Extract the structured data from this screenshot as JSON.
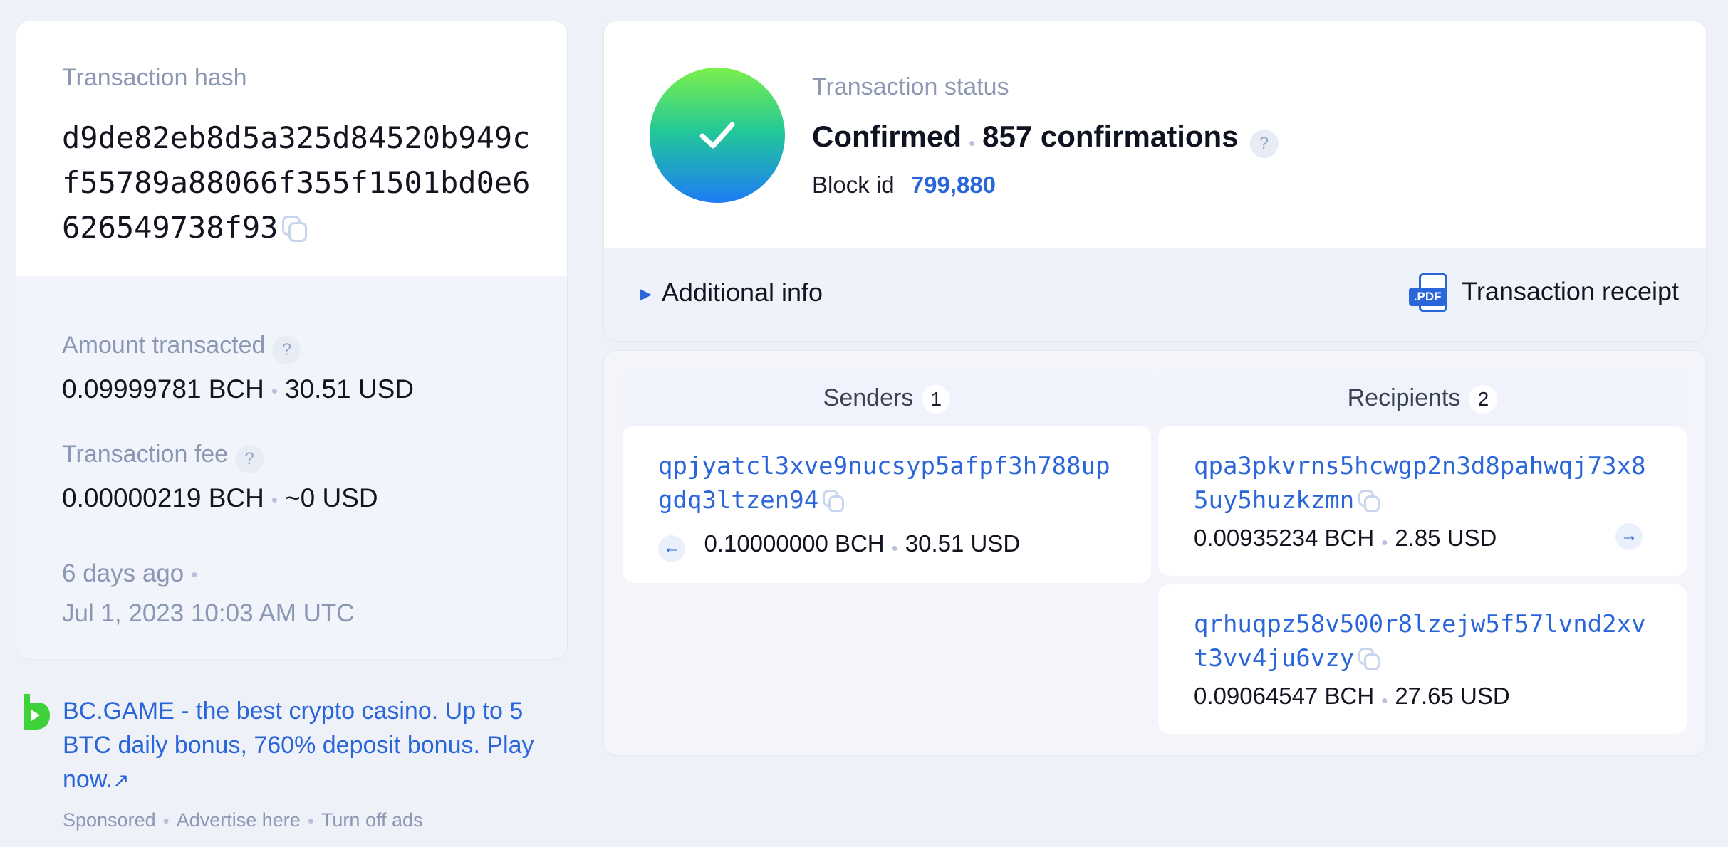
{
  "tx": {
    "hash_label": "Transaction hash",
    "hash": "d9de82eb8d5a325d84520b949cf55789a88066f355f1501bd0e6626549738f93",
    "amount_label": "Amount transacted",
    "amount_bch": "0.09999781 BCH",
    "amount_usd": "30.51 USD",
    "fee_label": "Transaction fee",
    "fee_bch": "0.00000219 BCH",
    "fee_usd": "~0 USD",
    "time_ago": "6 days ago",
    "datetime": "Jul 1, 2023 10:03 AM UTC"
  },
  "status": {
    "label": "Transaction status",
    "state": "Confirmed",
    "confirmations": "857 confirmations",
    "block_label": "Block id",
    "block_id": "799,880",
    "additional_info": "Additional info",
    "receipt": "Transaction receipt",
    "pdf_badge": ".PDF"
  },
  "senders": {
    "title": "Senders",
    "count": "1",
    "items": [
      {
        "address": "qpjyatcl3xve9nucsyp5afpf3h788upgdq3ltzen94",
        "bch": "0.10000000 BCH",
        "usd": "30.51 USD"
      }
    ]
  },
  "recipients": {
    "title": "Recipients",
    "count": "2",
    "items": [
      {
        "address": "qpa3pkvrns5hcwgp2n3d8pahwqj73x85uy5huzkzmn",
        "bch": "0.00935234 BCH",
        "usd": "2.85 USD"
      },
      {
        "address": "qrhuqpz58v500r8lzejw5f57lvnd2xvt3vv4ju6vzy",
        "bch": "0.09064547 BCH",
        "usd": "27.65 USD"
      }
    ]
  },
  "ad": {
    "text": "BC.GAME - the best crypto casino. Up to 5 BTC daily bonus, 760% deposit bonus. Play now.",
    "sponsored": "Sponsored",
    "advertise": "Advertise here",
    "turn_off": "Turn off ads"
  },
  "icons": {
    "help": "?",
    "arrow_left": "←",
    "arrow_right": "→",
    "external": "↗"
  }
}
